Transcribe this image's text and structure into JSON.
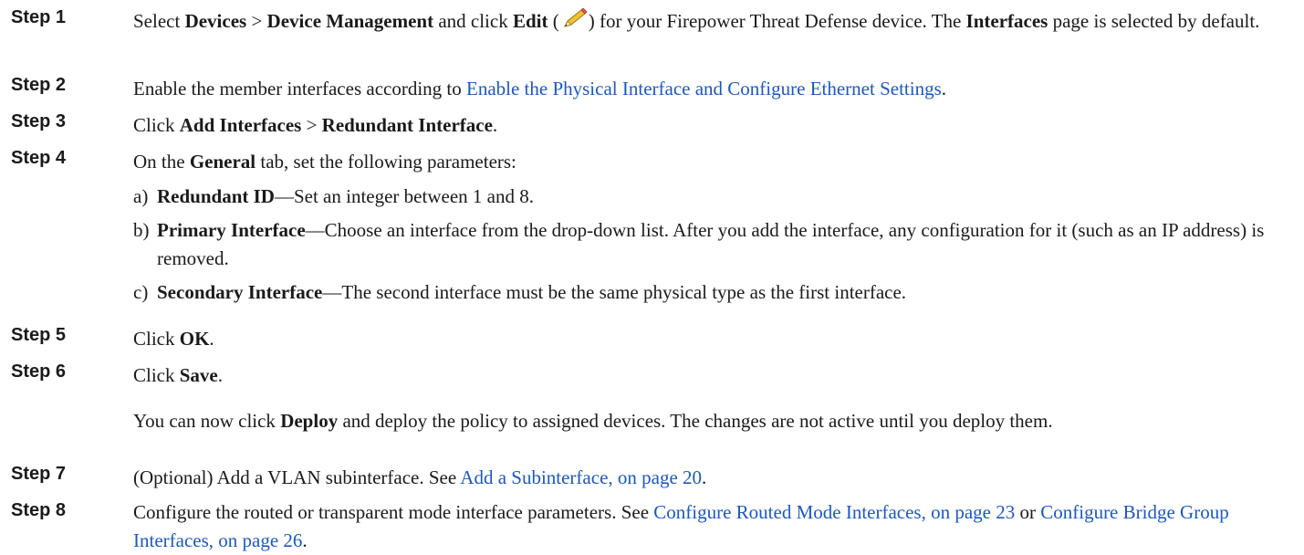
{
  "steps": [
    {
      "label": "Step 1",
      "t1": "Select ",
      "b1": "Devices",
      "t2": " > ",
      "b2": "Device Management",
      "t3": " and click ",
      "b3": "Edit",
      "t4": " (",
      "icon": "pencil-edit-icon",
      "t5": ") for your Firepower Threat Defense device. The ",
      "b4": "Interfaces",
      "t6": " page is selected by default."
    },
    {
      "label": "Step 2",
      "t1": "Enable the member interfaces according to ",
      "link": "Enable the Physical Interface and Configure Ethernet Settings",
      "t2": "."
    },
    {
      "label": "Step 3",
      "t1": "Click ",
      "b1": "Add Interfaces",
      "t2": " > ",
      "b2": "Redundant Interface",
      "t3": "."
    },
    {
      "label": "Step 4",
      "t1": "On the ",
      "b1": "General",
      "t2": " tab, set the following parameters:",
      "items": [
        {
          "letter": "a)",
          "term": "Redundant ID",
          "text": "—Set an integer between 1 and 8."
        },
        {
          "letter": "b)",
          "term": "Primary Interface",
          "text": "—Choose an interface from the drop-down list. After you add the interface, any configuration for it (such as an IP address) is removed."
        },
        {
          "letter": "c)",
          "term": "Secondary Interface",
          "text": "—The second interface must be the same physical type as the first interface."
        }
      ]
    },
    {
      "label": "Step 5",
      "t1": "Click ",
      "b1": "OK",
      "t2": "."
    },
    {
      "label": "Step 6",
      "t1": "Click ",
      "b1": "Save",
      "t2": ".",
      "note_t1": "You can now click ",
      "note_b1": "Deploy",
      "note_t2": " and deploy the policy to assigned devices. The changes are not active until you deploy them."
    },
    {
      "label": "Step 7",
      "t1": "(Optional) Add a VLAN subinterface. See ",
      "link": "Add a Subinterface, on page 20",
      "t2": "."
    },
    {
      "label": "Step 8",
      "t1": "Configure the routed or transparent mode interface parameters. See ",
      "link1": "Configure Routed Mode Interfaces, on page 23",
      "t2": " or ",
      "link2": "Configure Bridge Group Interfaces, on page 26",
      "t3": "."
    }
  ]
}
